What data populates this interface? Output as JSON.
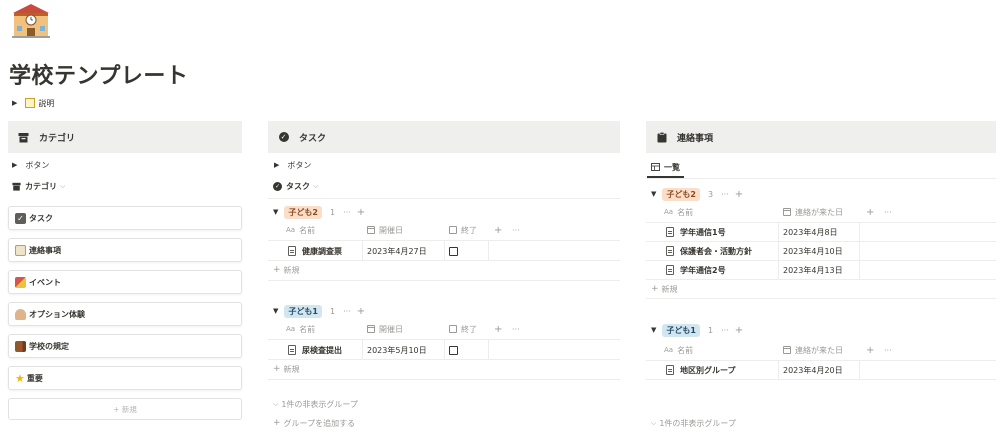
{
  "page": {
    "title": "学校テンプレート",
    "description_label": "説明"
  },
  "left": {
    "header": "カテゴリ",
    "button_label": "ボタン",
    "view_label": "カテゴリ",
    "cards": [
      {
        "label": "タスク",
        "icon": "checkbox-icon"
      },
      {
        "label": "連絡事項",
        "icon": "notepad-icon"
      },
      {
        "label": "イベント",
        "icon": "circus-tent-icon"
      },
      {
        "label": "オプション体験",
        "icon": "student-icon"
      },
      {
        "label": "学校の規定",
        "icon": "books-icon"
      },
      {
        "label": "重要",
        "icon": "star-icon"
      }
    ],
    "new_label": "+ 新規"
  },
  "middle": {
    "header": "タスク",
    "button_label": "ボタン",
    "view_label": "タスク",
    "groups": [
      {
        "tag": "子ども2",
        "count": "1",
        "columns": [
          "名前",
          "開催日",
          "終了"
        ],
        "rows": [
          {
            "name": "健康調査票",
            "date": "2023年4月27日",
            "done": false
          }
        ],
        "new_label": "新規"
      },
      {
        "tag": "子ども1",
        "count": "1",
        "columns": [
          "名前",
          "開催日",
          "終了"
        ],
        "rows": [
          {
            "name": "尿検査提出",
            "date": "2023年5月10日",
            "done": false
          }
        ],
        "new_label": "新規"
      }
    ],
    "hidden_groups": "1件の非表示グループ",
    "add_group": "グループを追加する"
  },
  "right": {
    "header": "連絡事項",
    "tab_label": "一覧",
    "groups": [
      {
        "tag": "子ども2",
        "count": "3",
        "columns": [
          "名前",
          "連絡が来た日"
        ],
        "rows": [
          {
            "name": "学年通信1号",
            "date": "2023年4月8日"
          },
          {
            "name": "保護者会・活動方針",
            "date": "2023年4月10日"
          },
          {
            "name": "学年通信2号",
            "date": "2023年4月13日"
          }
        ],
        "new_label": "新規"
      },
      {
        "tag": "子ども1",
        "count": "1",
        "columns": [
          "名前",
          "連絡が来た日"
        ],
        "rows": [
          {
            "name": "地区別グループ",
            "date": "2023年4月20日"
          }
        ]
      }
    ],
    "hidden_groups": "1件の非表示グループ"
  },
  "colors": {
    "header_bg": "#efefed",
    "tag_orange": "#fadec9",
    "tag_blue": "#d3e5ef"
  }
}
